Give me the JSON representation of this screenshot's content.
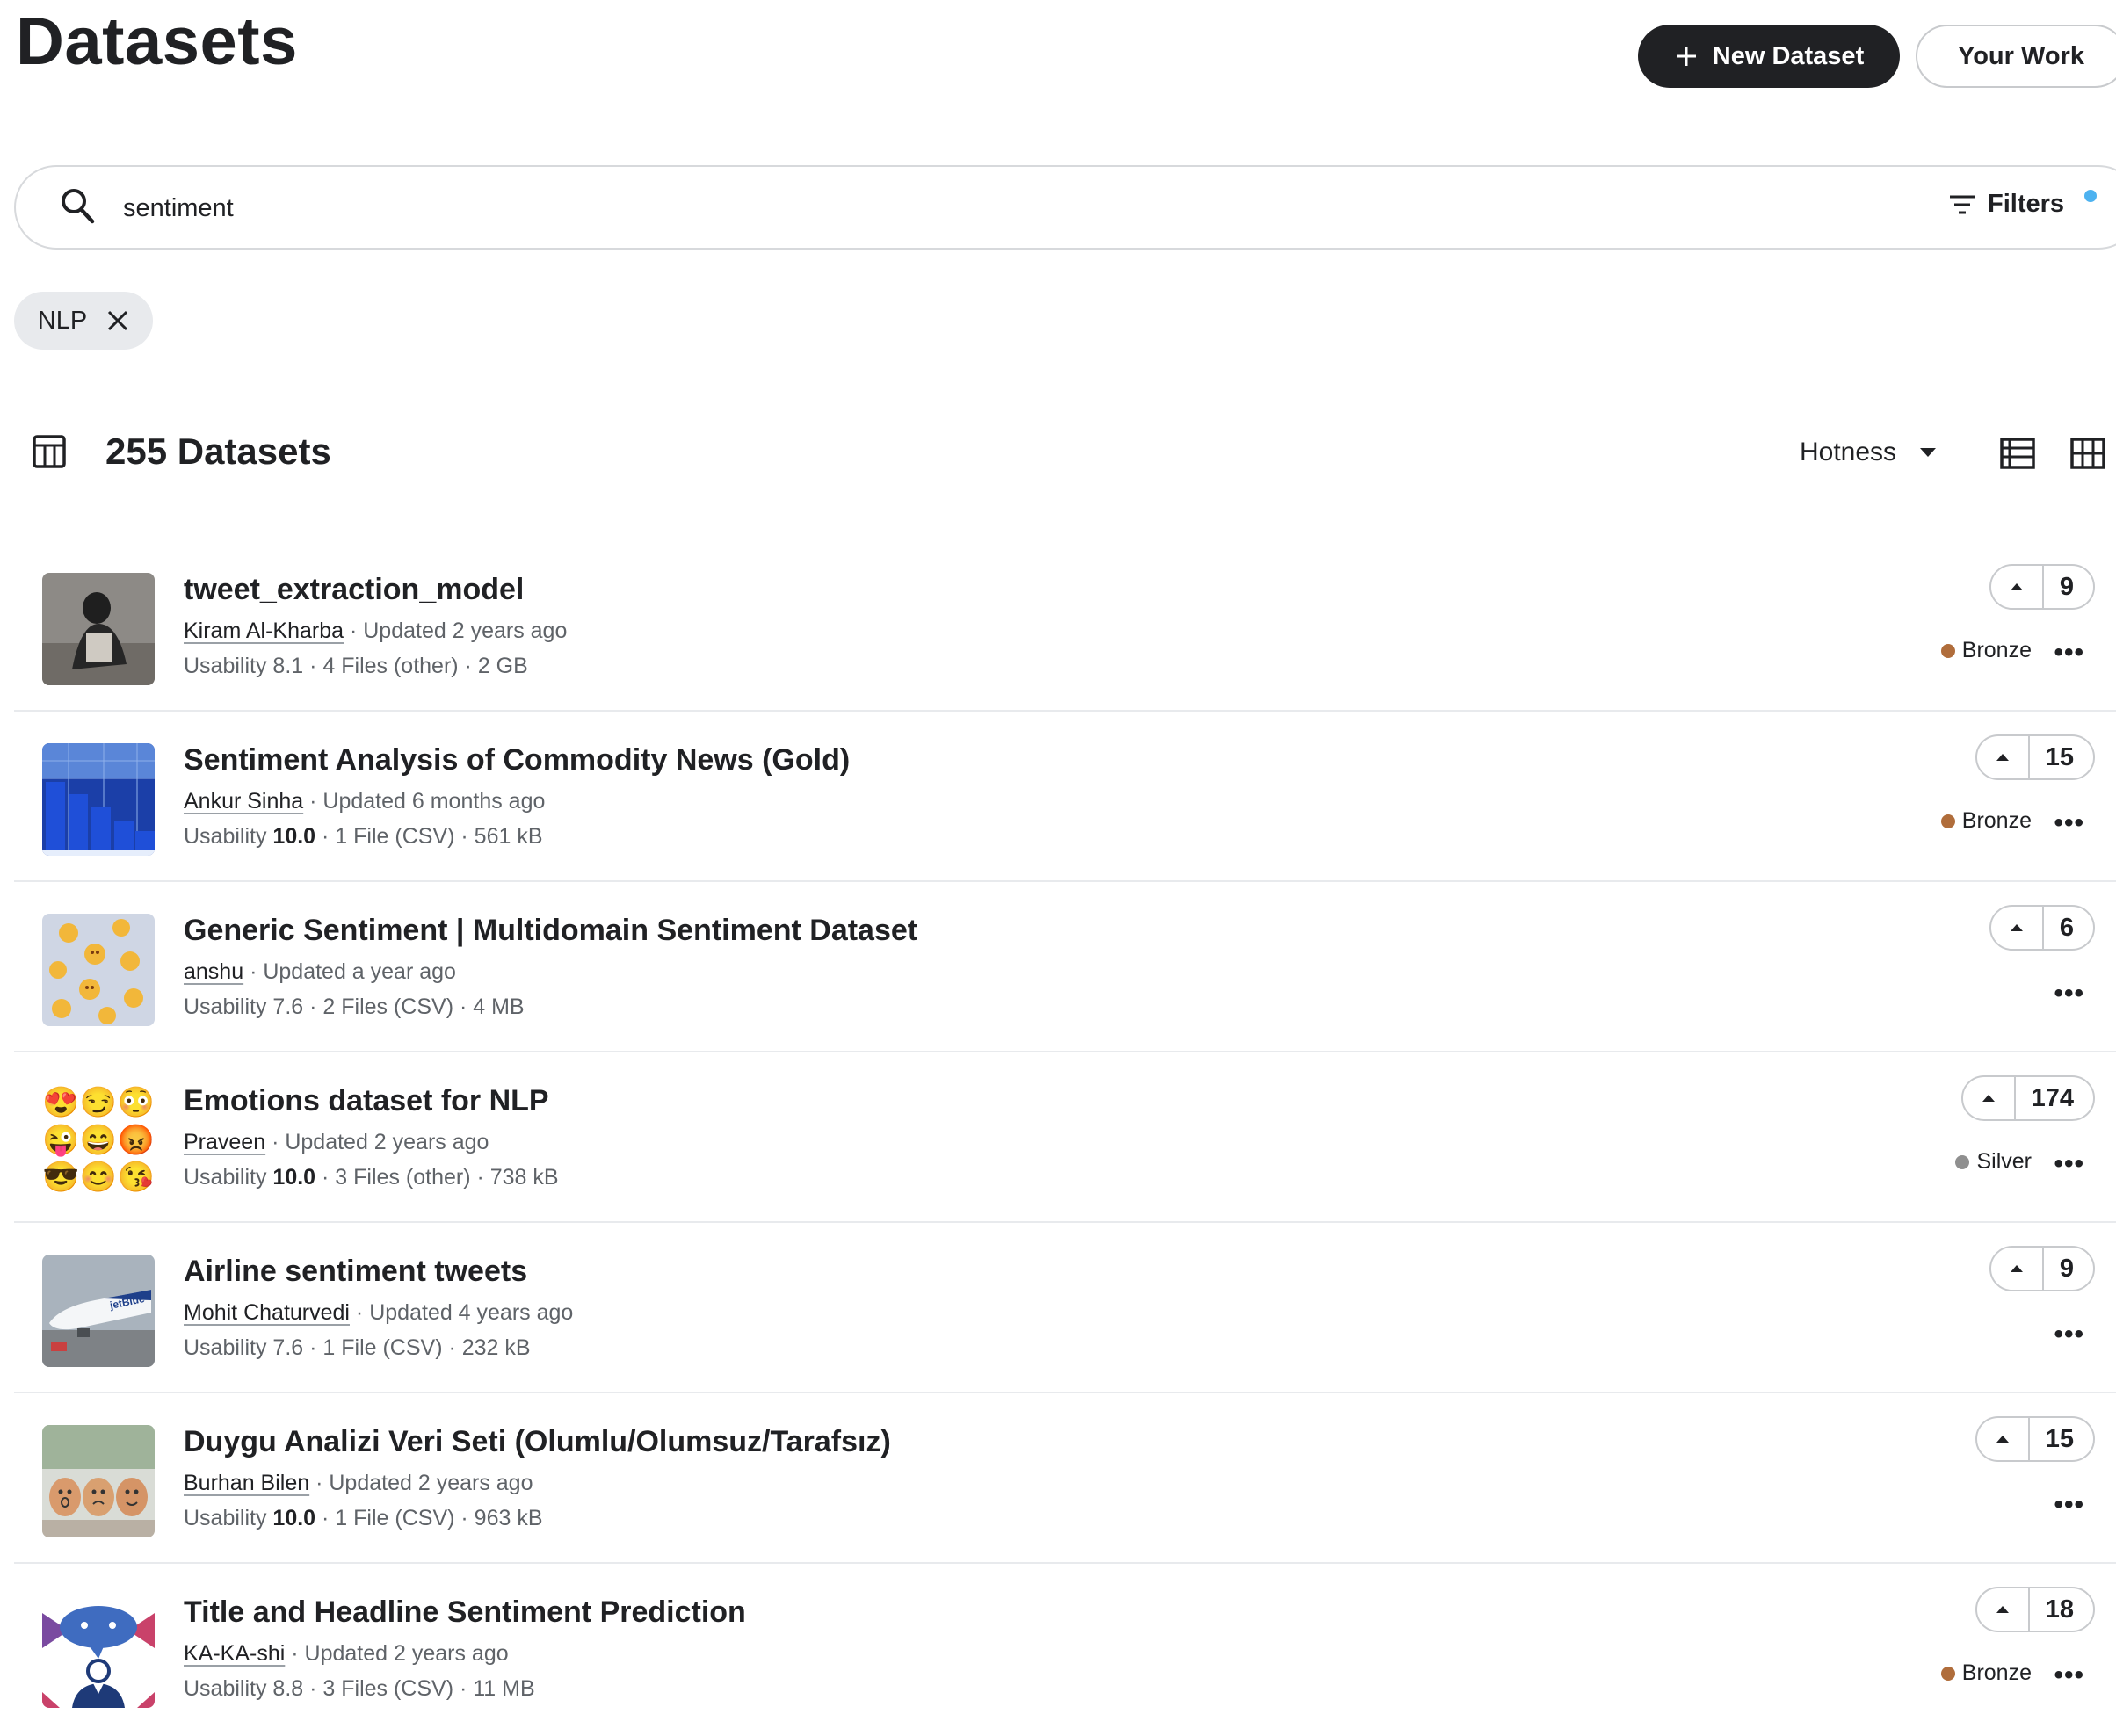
{
  "header": {
    "title": "Datasets",
    "new_dataset_label": "New Dataset",
    "your_work_label": "Your Work"
  },
  "search": {
    "value": "sentiment",
    "filters_label": "Filters"
  },
  "active_filter": {
    "label": "NLP"
  },
  "results": {
    "count_label": "255 Datasets",
    "sort_label": "Hotness"
  },
  "datasets": [
    {
      "title": "tweet_extraction_model",
      "author": "Kiram Al-Kharba",
      "updated": " · Updated 2 years ago",
      "usability_label": "Usability 8.1",
      "details": " · 4 Files (other) · 2 GB",
      "votes": "9",
      "medal": "Bronze",
      "medal_color": "#b06d3b",
      "thumb": "silhouette-photo"
    },
    {
      "title": "Sentiment Analysis of Commodity News (Gold)",
      "author": "Ankur Sinha",
      "updated": " · Updated 6 months ago",
      "usability_label": "Usability ",
      "usability_value": "10.0",
      "details": " · 1 File (CSV) · 561 kB",
      "votes": "15",
      "medal": "Bronze",
      "medal_color": "#b06d3b",
      "thumb": "blue-bar-chart"
    },
    {
      "title": "Generic Sentiment | Multidomain Sentiment Dataset",
      "author": "anshu",
      "updated": " · Updated a year ago",
      "usability_label": "Usability 7.6",
      "details": " · 2 Files (CSV) · 4 MB",
      "votes": "6",
      "medal": "",
      "thumb": "emoji-cloud"
    },
    {
      "title": "Emotions dataset for NLP",
      "author": "Praveen",
      "updated": " · Updated 2 years ago",
      "usability_label": "Usability ",
      "usability_value": "10.0",
      "details": " · 3 Files (other) · 738 kB",
      "votes": "174",
      "medal": "Silver",
      "medal_color": "#8f8f8f",
      "thumb": "emoji-grid",
      "emoji": [
        "😍",
        "😏",
        "😳",
        "😜",
        "😄",
        "😡",
        "😎",
        "😊",
        "😘"
      ]
    },
    {
      "title": "Airline sentiment tweets",
      "author": "Mohit Chaturvedi",
      "updated": " · Updated 4 years ago",
      "usability_label": "Usability 7.6",
      "details": " · 1 File (CSV) · 232 kB",
      "votes": "9",
      "medal": "",
      "thumb": "airplane-photo"
    },
    {
      "title": "Duygu Analizi Veri Seti (Olumlu/Olumsuz/Tarafsız)",
      "author": "Burhan Bilen",
      "updated": " · Updated 2 years ago",
      "usability_label": "Usability ",
      "usability_value": "10.0",
      "details": " · 1 File (CSV) · 963 kB",
      "votes": "15",
      "medal": "",
      "thumb": "eggs-photo"
    },
    {
      "title": "Title and Headline Sentiment Prediction",
      "author": "KA-KA-shi",
      "updated": " · Updated 2 years ago",
      "usability_label": "Usability 8.8",
      "details": " · 3 Files (CSV) · 11 MB",
      "votes": "18",
      "medal": "Bronze",
      "medal_color": "#b06d3b",
      "thumb": "chat-illustration"
    }
  ]
}
